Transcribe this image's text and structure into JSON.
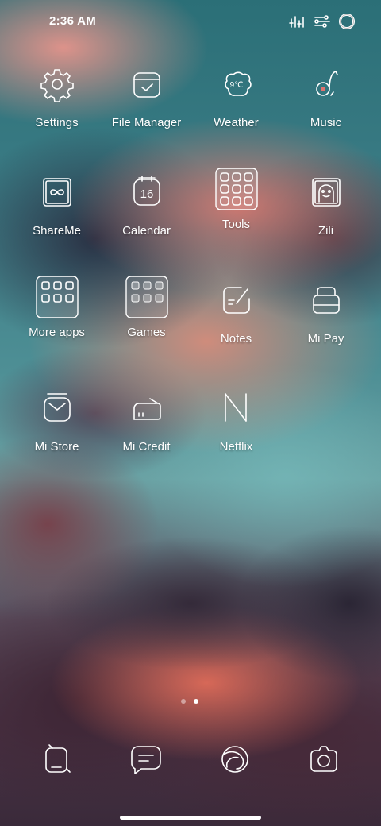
{
  "status_bar": {
    "time": "2:36 AM",
    "icons": [
      "equalizer-icon",
      "sliders-icon",
      "ring-icon"
    ]
  },
  "apps": [
    {
      "label": "Settings",
      "icon": "gear-icon"
    },
    {
      "label": "File Manager",
      "icon": "folder-check-icon"
    },
    {
      "label": "Weather",
      "icon": "weather-icon",
      "icon_text": "9℃"
    },
    {
      "label": "Music",
      "icon": "music-note-icon"
    },
    {
      "label": "ShareMe",
      "icon": "infinity-icon"
    },
    {
      "label": "Calendar",
      "icon": "calendar-icon",
      "icon_text": "16"
    },
    {
      "label": "Tools",
      "icon": "tools-folder-icon"
    },
    {
      "label": "Zili",
      "icon": "zili-icon"
    },
    {
      "label": "More apps",
      "icon": "folder-grid-icon"
    },
    {
      "label": "Games",
      "icon": "folder-grid-icon"
    },
    {
      "label": "Notes",
      "icon": "notes-icon"
    },
    {
      "label": "Mi Pay",
      "icon": "wallet-icon"
    },
    {
      "label": "Mi Store",
      "icon": "shopping-bag-icon"
    },
    {
      "label": "Mi Credit",
      "icon": "card-icon"
    },
    {
      "label": "Netflix",
      "icon": "netflix-n-icon"
    }
  ],
  "page_indicator": {
    "pages": 2,
    "current": 2
  },
  "dock": [
    {
      "icon": "phone-icon"
    },
    {
      "icon": "message-icon"
    },
    {
      "icon": "browser-icon"
    },
    {
      "icon": "camera-icon"
    }
  ]
}
